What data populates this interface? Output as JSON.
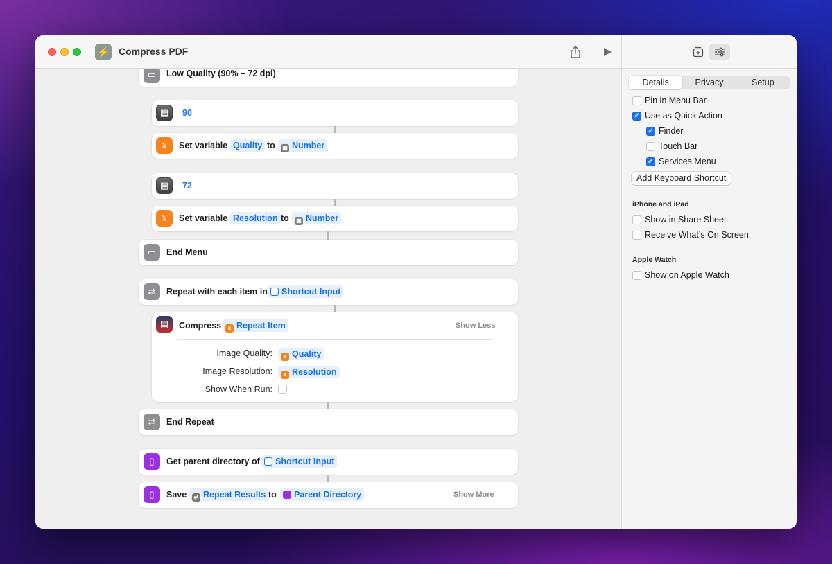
{
  "window": {
    "title": "Compress PDF"
  },
  "actions": {
    "low_quality": "Low Quality (90% – 72 dpi)",
    "number_90": "90",
    "set_var_1": {
      "label": "Set variable",
      "var": "Quality",
      "to": "to",
      "value": "Number"
    },
    "number_72": "72",
    "set_var_2": {
      "label": "Set variable",
      "var": "Resolution",
      "to": "to",
      "value": "Number"
    },
    "end_menu": "End Menu",
    "repeat": {
      "label": "Repeat with each item in",
      "value": "Shortcut Input"
    },
    "compress": {
      "label": "Compress",
      "value": "Repeat Item",
      "toggle": "Show Less",
      "params": [
        {
          "label": "Image Quality:",
          "value": "Quality"
        },
        {
          "label": "Image Resolution:",
          "value": "Resolution"
        },
        {
          "label": "Show When Run:",
          "value": ""
        }
      ]
    },
    "end_repeat": "End Repeat",
    "parent_dir": {
      "label": "Get parent directory of",
      "value": "Shortcut Input"
    },
    "save": {
      "label": "Save",
      "value": "Repeat Results",
      "to": "to",
      "dest": "Parent Directory",
      "toggle": "Show More"
    }
  },
  "sidebar": {
    "tabs": [
      "Details",
      "Privacy",
      "Setup"
    ],
    "active_tab": "Details",
    "pin_menu_bar": {
      "label": "Pin in Menu Bar",
      "checked": false
    },
    "quick_action": {
      "label": "Use as Quick Action",
      "checked": true
    },
    "finder": {
      "label": "Finder",
      "checked": true
    },
    "touch_bar": {
      "label": "Touch Bar",
      "checked": false
    },
    "services_menu": {
      "label": "Services Menu",
      "checked": true
    },
    "keyboard_button": "Add Keyboard Shortcut",
    "iphone_heading": "iPhone and iPad",
    "share_sheet": {
      "label": "Show in Share Sheet",
      "checked": false
    },
    "whats_on_screen": {
      "label": "Receive What’s On Screen",
      "checked": false
    },
    "watch_heading": "Apple Watch",
    "show_watch": {
      "label": "Show on Apple Watch",
      "checked": false
    }
  },
  "colors": {
    "accent": "#1a73e8",
    "variable_orange": "#f5841f",
    "file_purple": "#9b30e0"
  }
}
